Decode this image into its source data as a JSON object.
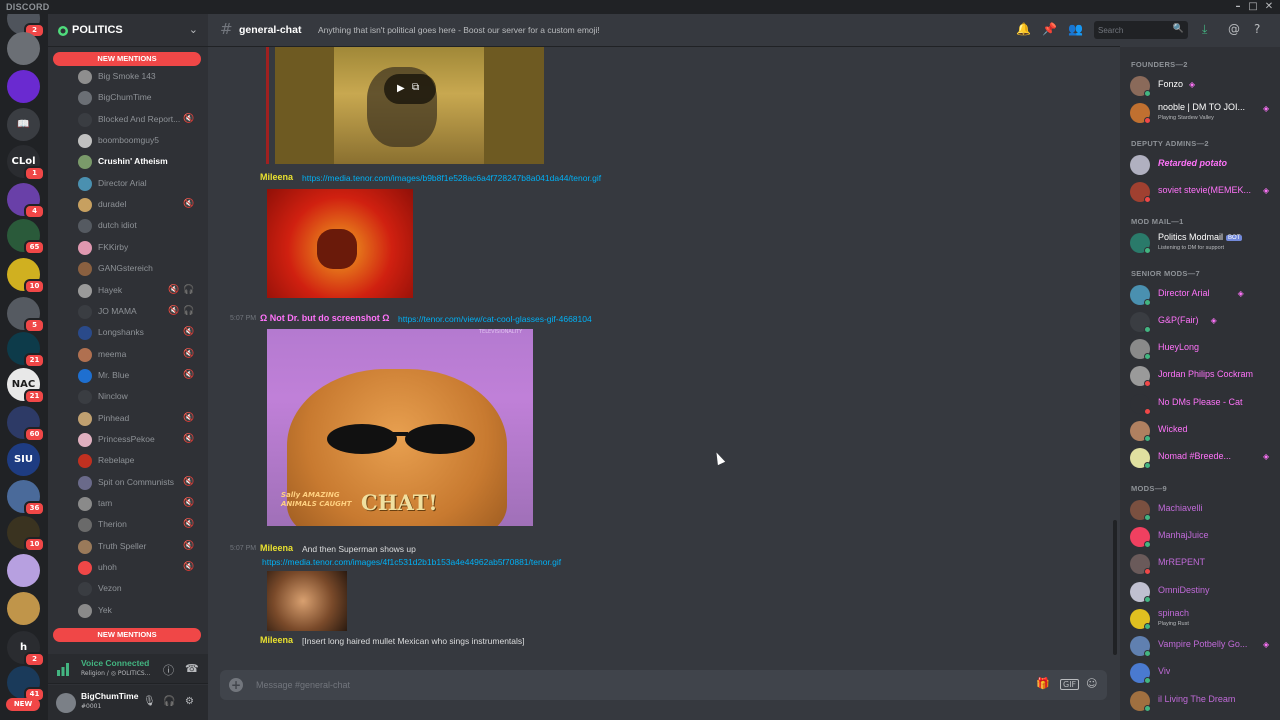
{
  "titlebar": {
    "app": "DISCORD",
    "minimize": "–",
    "maximize": "□",
    "close": "✕"
  },
  "colors": {
    "mention_red": "#f04747",
    "online": "#43b581",
    "idle": "#faa61a",
    "dnd": "#f04747",
    "link": "#00b0f4",
    "nitro_pink": "#ff73fa",
    "accent": "#7289da"
  },
  "guilds": [
    {
      "label": "",
      "badge": "2",
      "color": "#4f545c"
    },
    {
      "label": "",
      "badge": "",
      "color": "#6b6f75"
    },
    {
      "label": "",
      "badge": "",
      "color": "#6a2ad0"
    },
    {
      "label": "📖",
      "badge": "",
      "color": "#3a3d42"
    },
    {
      "label": "CLol",
      "badge": "1",
      "color": "#2a2c30"
    },
    {
      "label": "",
      "badge": "4",
      "color": "#6940a8"
    },
    {
      "label": "",
      "badge": "65",
      "color": "#2a5a3a"
    },
    {
      "label": "",
      "badge": "10",
      "color": "#d0b020"
    },
    {
      "label": "",
      "badge": "5",
      "color": "#555a61"
    },
    {
      "label": "",
      "badge": "21",
      "color": "#0d3b4a"
    },
    {
      "label": "NAC",
      "badge": "21",
      "color": "#e8e8e8"
    },
    {
      "label": "",
      "badge": "60",
      "color": "#2d3a66"
    },
    {
      "label": "SIU",
      "badge": "",
      "color": "#1e3c82"
    },
    {
      "label": "",
      "badge": "36",
      "color": "#4a6a9a"
    },
    {
      "label": "",
      "badge": "10",
      "color": "#3a3320"
    },
    {
      "label": "",
      "badge": "",
      "color": "#b7a0e0"
    },
    {
      "label": "",
      "badge": "",
      "color": "#c0954a"
    },
    {
      "label": "h",
      "badge": "2",
      "color": "#2a2c30"
    },
    {
      "label": "",
      "badge": "41",
      "color": "#1a3a5a"
    }
  ],
  "guild_new_label": "NEW",
  "server": {
    "name": "POLITICS",
    "chevron": "⌄"
  },
  "new_mentions_label": "NEW MENTIONS",
  "channels": [
    {
      "label": "Big Smoke 143",
      "av": "#8e8e8e",
      "icons": [],
      "bright": false
    },
    {
      "label": "BigChumTime",
      "av": "#6b6f75",
      "icons": [],
      "bright": false
    },
    {
      "label": "Blocked And Report...",
      "av": "#3a3d42",
      "icons": [
        "🔇"
      ],
      "bright": false
    },
    {
      "label": "boomboomguy5",
      "av": "#c0c0c0",
      "icons": [],
      "bright": false
    },
    {
      "label": "Crushin' Atheism",
      "av": "#7a9a6a",
      "icons": [],
      "bright": true
    },
    {
      "label": "Director Arial",
      "av": "#4a90b0",
      "icons": [],
      "bright": false
    },
    {
      "label": "duradel",
      "av": "#c7a060",
      "icons": [
        "🔇"
      ],
      "bright": false
    },
    {
      "label": "dutch idiot",
      "av": "#555a61",
      "icons": [],
      "bright": false
    },
    {
      "label": "FKKirby",
      "av": "#e098b0",
      "icons": [],
      "bright": false
    },
    {
      "label": "GANGstereich",
      "av": "#8a6040",
      "icons": [],
      "bright": false
    },
    {
      "label": "Hayek",
      "av": "#9a9a9a",
      "icons": [
        "🔇",
        "🎧"
      ],
      "bright": false
    },
    {
      "label": "JO MAMA",
      "av": "#3a3d42",
      "icons": [
        "🔇",
        "🎧"
      ],
      "bright": false
    },
    {
      "label": "Longshanks",
      "av": "#2a4a8a",
      "icons": [
        "🔇"
      ],
      "bright": false
    },
    {
      "label": "meema",
      "av": "#b07050",
      "icons": [
        "🔇"
      ],
      "bright": false
    },
    {
      "label": "Mr. Blue",
      "av": "#1e6fd0",
      "icons": [
        "🔇"
      ],
      "bright": false
    },
    {
      "label": "Ninclow",
      "av": "#3a3d42",
      "icons": [],
      "bright": false
    },
    {
      "label": "Pinhead",
      "av": "#c0a070",
      "icons": [
        "🔇"
      ],
      "bright": false
    },
    {
      "label": "PrincessPekoe",
      "av": "#e0b0c0",
      "icons": [
        "🔇"
      ],
      "bright": false
    },
    {
      "label": "Rebelape",
      "av": "#c03020",
      "icons": [],
      "bright": false
    },
    {
      "label": "Spit on Communists",
      "av": "#6a6a8a",
      "icons": [
        "🔇"
      ],
      "bright": false
    },
    {
      "label": "tam",
      "av": "#8a8a8a",
      "icons": [
        "🔇"
      ],
      "bright": false
    },
    {
      "label": "Therion",
      "av": "#6a6a6a",
      "icons": [
        "🔇"
      ],
      "bright": false
    },
    {
      "label": "Truth Speller",
      "av": "#9a7a5a",
      "icons": [
        "🔇"
      ],
      "bright": false
    },
    {
      "label": "uhoh",
      "av": "#f04747",
      "icons": [
        "🔇"
      ],
      "bright": false
    },
    {
      "label": "Vezon",
      "av": "#3a3d42",
      "icons": [],
      "bright": false
    },
    {
      "label": "Yek",
      "av": "#8a8a8a",
      "icons": [],
      "bright": false
    }
  ],
  "voice": {
    "status": "Voice Connected",
    "sub": "Religion / ◎ POLITICS..."
  },
  "user": {
    "name": "BigChumTime",
    "tag": "#0001"
  },
  "chat": {
    "channel": "general-chat",
    "topic": "Anything that isn't political goes here - Boost our server for a custom emoji!"
  },
  "search": {
    "placeholder": "Search"
  },
  "messages": [
    {
      "author": "Mileena",
      "link": "https://media.tenor.com/images/b9b8f1e528ac6a4f728247b8a041da44/tenor.gif",
      "color": "#e8e030",
      "ts": ""
    },
    {
      "author": "Ω Not Dr. but do screenshot Ω",
      "link": "https://tenor.com/view/cat-cool-glasses-gif-4668104",
      "color": "#ff73fa",
      "ts": "5:07 PM"
    },
    {
      "author": "Mileena",
      "text": "And then Superman shows up",
      "link": "https://media.tenor.com/images/4f1c531d2b1b153a4e44962ab5f70881/tenor.gif",
      "color": "#e8e030",
      "ts": "5:07 PM"
    },
    {
      "author": "Mileena",
      "text": "[Insert long haired mullet Mexican who sings instrumentals]",
      "color": "#e8e030",
      "ts": ""
    }
  ],
  "gif_caption": "CHAT!",
  "gif_corner": "Sally AMAZING ANIMALS CAUGHT",
  "gif_watermark": "TELEVISIONALITY",
  "composer": {
    "placeholder": "Message #general-chat"
  },
  "members": {
    "roles": [
      {
        "header": "FOUNDERS—2",
        "members": [
          {
            "name": "Fonzo",
            "color": "#ffffff",
            "status": "online",
            "boost": true,
            "sub": "",
            "av": "#8a6a5a"
          },
          {
            "name": "nooble | DM TO JOI...",
            "color": "#ffffff",
            "status": "dnd",
            "boost": true,
            "sub": "Playing Stardew Valley",
            "av": "#c07030"
          }
        ]
      },
      {
        "header": "DEPUTY ADMINS—2",
        "members": [
          {
            "name": "Retarded potato",
            "color": "#ff73fa",
            "status": "",
            "boost": false,
            "sub": "",
            "av": "#b0b0c0",
            "italic": true
          },
          {
            "name": "soviet stevie(MEMEK...",
            "color": "#ff73fa",
            "status": "dnd",
            "boost": true,
            "sub": "",
            "av": "#a04030"
          }
        ]
      },
      {
        "header": "MOD MAIL—1",
        "members": [
          {
            "name": "Politics Modmail",
            "color": "#ffffff",
            "status": "online",
            "boost": false,
            "bot": "BOT",
            "sub": "Listening to DM for support",
            "av": "#2a7a6a"
          }
        ]
      },
      {
        "header": "SENIOR MODS—7",
        "members": [
          {
            "name": "Director Arial",
            "color": "#ff73fa",
            "status": "online",
            "boost": true,
            "sub": "",
            "av": "#4a90b0"
          },
          {
            "name": "G&P(Fair)",
            "color": "#ff73fa",
            "status": "online",
            "boost": true,
            "sub": "",
            "av": "#3a3d42"
          },
          {
            "name": "HueyLong",
            "color": "#ff73fa",
            "status": "online",
            "boost": false,
            "sub": "",
            "av": "#8a8a8a"
          },
          {
            "name": "Jordan Philips Cockram",
            "color": "#ff73fa",
            "status": "dnd",
            "boost": false,
            "sub": "",
            "av": "#9a9a9a"
          },
          {
            "name": "No DMs Please - Cat",
            "color": "#ff73fa",
            "status": "dnd",
            "boost": false,
            "sub": "",
            "av": "#2f3136"
          },
          {
            "name": "Wicked",
            "color": "#ff73fa",
            "status": "online",
            "boost": false,
            "sub": "",
            "av": "#b08060"
          },
          {
            "name": "Nomad #Breede...",
            "color": "#ff73fa",
            "status": "online",
            "boost": true,
            "sub": "",
            "av": "#e0e0a0"
          }
        ]
      },
      {
        "header": "MODS—9",
        "members": [
          {
            "name": "Machiavelli",
            "color": "#c06ad8",
            "status": "online",
            "boost": false,
            "sub": "",
            "av": "#7a5040"
          },
          {
            "name": "ManhajJuice",
            "color": "#c06ad8",
            "status": "online",
            "boost": false,
            "sub": "",
            "av": "#f04060"
          },
          {
            "name": "MrREPENT",
            "color": "#c06ad8",
            "status": "dnd",
            "boost": false,
            "sub": "",
            "av": "#6a5a5a"
          },
          {
            "name": "OmniDestiny",
            "color": "#c06ad8",
            "status": "online",
            "boost": false,
            "sub": "",
            "av": "#c0c0d0"
          },
          {
            "name": "spinach",
            "color": "#c06ad8",
            "status": "online",
            "boost": false,
            "sub": "Playing Rust",
            "av": "#e0c020"
          },
          {
            "name": "Vampire Potbelly Go...",
            "color": "#c06ad8",
            "status": "online",
            "boost": true,
            "sub": "",
            "av": "#6080b0"
          },
          {
            "name": "Viv",
            "color": "#c06ad8",
            "status": "online",
            "boost": false,
            "sub": "",
            "av": "#4a7ad0"
          },
          {
            "name": "il Living The Dream",
            "color": "#c06ad8",
            "status": "online",
            "boost": false,
            "sub": "",
            "av": "#a07040"
          }
        ]
      }
    ]
  }
}
